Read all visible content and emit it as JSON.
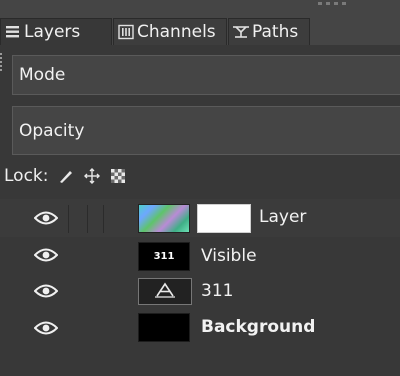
{
  "tabs": [
    {
      "label": "Layers",
      "icon": "layers-icon",
      "active": true
    },
    {
      "label": "Channels",
      "icon": "channels-icon",
      "active": false
    },
    {
      "label": "Paths",
      "icon": "paths-icon",
      "active": false
    }
  ],
  "mode": {
    "label": "Mode"
  },
  "opacity": {
    "label": "Opacity"
  },
  "lock": {
    "label": "Lock:",
    "icons": [
      "lock-pixels-icon",
      "lock-position-icon",
      "lock-alpha-icon"
    ]
  },
  "layers": [
    {
      "name": "Layer",
      "visible": true,
      "selected": true,
      "thumbnail": "gradient",
      "has_mask": true
    },
    {
      "name": "Visible",
      "visible": true,
      "selected": false,
      "thumbnail": "text",
      "thumbnail_text": "311"
    },
    {
      "name": "311",
      "visible": true,
      "selected": false,
      "thumbnail": "text-layer-icon"
    },
    {
      "name": "Background",
      "visible": true,
      "selected": false,
      "thumbnail": "black",
      "bold": true
    }
  ]
}
